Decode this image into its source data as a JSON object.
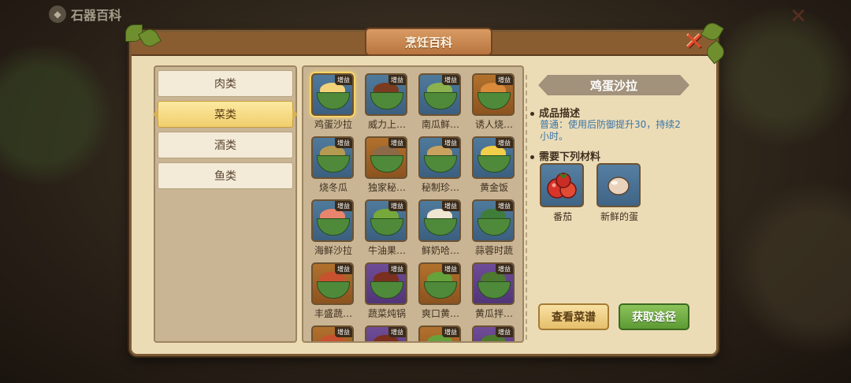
{
  "brand": {
    "title": "石器百科",
    "logo_icon": "stone-logo-icon"
  },
  "window": {
    "title": "烹饪百科",
    "close_icon": "close-x-icon"
  },
  "categories": [
    {
      "label": "肉类",
      "active": false
    },
    {
      "label": "菜类",
      "active": true
    },
    {
      "label": "酒类",
      "active": false
    },
    {
      "label": "鱼类",
      "active": false
    }
  ],
  "badge_text": "增益",
  "dishes": [
    {
      "name": "鸡蛋沙拉",
      "frame": "blue",
      "selected": true
    },
    {
      "name": "威力上…",
      "frame": "blue"
    },
    {
      "name": "南瓜鲜…",
      "frame": "blue"
    },
    {
      "name": "诱人烧…",
      "frame": "brown"
    },
    {
      "name": "烧冬瓜",
      "frame": "blue"
    },
    {
      "name": "独家秘…",
      "frame": "brown"
    },
    {
      "name": "秘制珍…",
      "frame": "blue"
    },
    {
      "name": "黄金饭",
      "frame": "blue"
    },
    {
      "name": "海鲜沙拉",
      "frame": "blue"
    },
    {
      "name": "牛油果…",
      "frame": "blue"
    },
    {
      "name": "鲜奶哈…",
      "frame": "blue"
    },
    {
      "name": "蒜蓉时蔬",
      "frame": "blue"
    },
    {
      "name": "丰盛蔬…",
      "frame": "brown"
    },
    {
      "name": "蔬菜炖锅",
      "frame": "purple"
    },
    {
      "name": "爽口黄…",
      "frame": "brown"
    },
    {
      "name": "黄瓜拌…",
      "frame": "purple"
    },
    {
      "name": "",
      "frame": "brown"
    },
    {
      "name": "",
      "frame": "purple"
    },
    {
      "name": "",
      "frame": "brown"
    },
    {
      "name": "",
      "frame": "purple"
    }
  ],
  "detail": {
    "title": "鸡蛋沙拉",
    "desc_heading": "成品描述",
    "description": "普通：使用后防御提升30，持续2小时。",
    "materials_heading": "需要下列材料",
    "materials": [
      {
        "name": "番茄",
        "icon": "tomato-icon"
      },
      {
        "name": "新鲜的蛋",
        "icon": "egg-icon"
      }
    ],
    "view_recipe_label": "查看菜谱",
    "obtain_label": "获取途径"
  },
  "colors": {
    "blue_frame": "#4f7a9c",
    "brown_frame": "#b2712d",
    "purple_frame": "#6f4c97",
    "desc_text": "#3a74a8"
  }
}
